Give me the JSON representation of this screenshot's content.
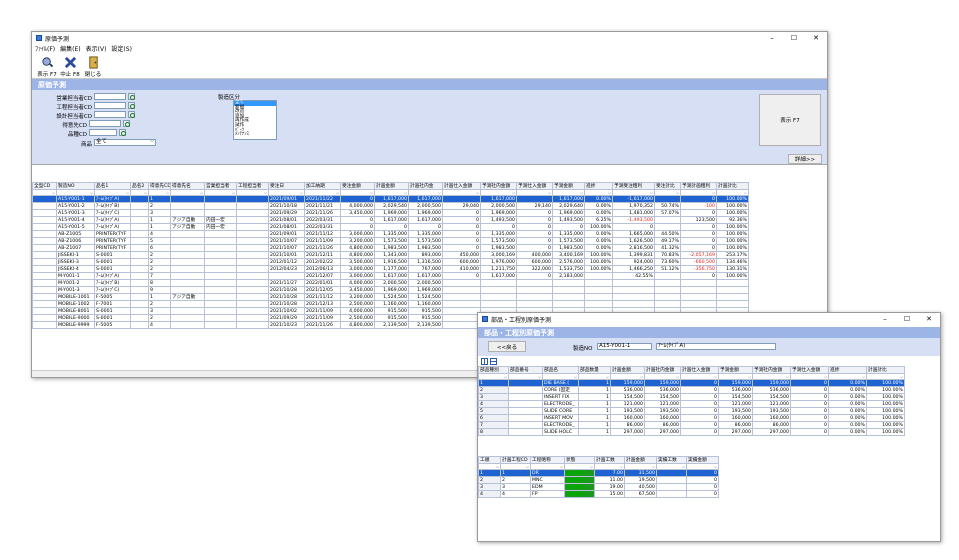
{
  "main": {
    "title": "原価予測",
    "menu": [
      "ﾌｧｲﾙ(F)",
      "編集(E)",
      "表示(V)",
      "設定(S)"
    ],
    "toolbar": [
      {
        "label": "表示 F7",
        "icon": "search-person-icon"
      },
      {
        "label": "中止 F8",
        "icon": "cross-stop-icon"
      },
      {
        "label": "閉じる",
        "icon": "close-door-icon"
      }
    ],
    "banner": "原価予測",
    "form": {
      "sales_mgr_label": "営業担当者CD",
      "process_mgr_label": "工程担当者CD",
      "design_mgr_label": "設計担当者CD",
      "customer_label": "得意先CD",
      "product_type_label": "品種CD",
      "product_label": "商品",
      "product_value": "全て",
      "manufacture_label": "製造区分",
      "manufacture_options": [
        "全て",
        "新規",
        "改造",
        "追加",
        "再作成",
        "試作",
        "ﾊﾟｰﾂ",
        "ﾒﾝﾃﾅﾝｽ"
      ],
      "show_button": "表示 F7"
    },
    "detail_button": "詳細>>",
    "columns": [
      "全型CD",
      "製造NO",
      "品名1",
      "品名2",
      "得意先CD",
      "得意先名",
      "営業担当者",
      "工程担当者",
      "受注日",
      "加工納期",
      "受注金額",
      "計画金額",
      "計画社内金",
      "計画仕入金額",
      "予測社内金額",
      "予測仕入金額",
      "予測金額",
      "進捗",
      "予測受注粗利",
      "受注計比",
      "予測計画粗利",
      "計画計比"
    ],
    "rows": [
      [
        "",
        "A15-Y001-1",
        "ｱｰﾑ(ﾀｲﾌﾟA)",
        "",
        "1",
        "",
        "",
        "",
        "2021/09/01",
        "2021/11/22",
        "0",
        "1,617,000",
        "1,617,000",
        "",
        "1,617,000",
        "",
        "1,617,000",
        "0.00%",
        "-1,617,000",
        "",
        "0",
        "100.00%"
      ],
      [
        "",
        "A15-Y001-2",
        "ｱｰﾑ(ﾀｲﾌﾟB)",
        "",
        "2",
        "",
        "",
        "",
        "2021/10/18",
        "2021/11/21",
        "4,000,000",
        "2,029,540",
        "2,000,500",
        "29,040",
        "2,000,500",
        "29,140",
        "2,029,640",
        "0.00%",
        "1,970,352",
        "50.74%",
        "-100",
        "100.00%"
      ],
      [
        "",
        "A15-Y001-3",
        "ｱｰﾑ(ﾀｲﾌﾟC)",
        "",
        "3",
        "",
        "",
        "",
        "2021/09/29",
        "2021/11/26",
        "3,450,000",
        "1,969,000",
        "1,969,000",
        "0",
        "1,969,000",
        "0",
        "1,969,000",
        "0.00%",
        "1,481,000",
        "57.07%",
        "0",
        "100.00%"
      ],
      [
        "",
        "A15-Y001-4",
        "ｱｰﾑ(ﾀｲﾌﾟA)",
        "",
        "1",
        "アジア自動",
        "内田一宏",
        "",
        "2021/08/01",
        "2022/03/31",
        "0",
        "1,617,000",
        "1,617,000",
        "0",
        "1,493,500",
        "0",
        "1,493,500",
        "6.25%",
        "-1,493,500",
        "",
        "123,500",
        "92.36%"
      ],
      [
        "",
        "A15-Y001-5",
        "ｱｰﾑ(ﾀｲﾌﾟA)",
        "",
        "1",
        "アジア自動",
        "内田一宏",
        "",
        "2021/08/01",
        "2022/03/31",
        "0",
        "0",
        "0",
        "0",
        "0",
        "0",
        "0",
        "100.00%",
        "0",
        "",
        "0",
        "100.00%"
      ],
      [
        "",
        "AB-Z1005",
        "PRINTER(TYF",
        "",
        "4",
        "",
        "",
        "",
        "2021/09/01",
        "2021/11/12",
        "3,000,000",
        "1,335,000",
        "1,335,000",
        "0",
        "1,335,000",
        "0",
        "1,335,000",
        "0.00%",
        "1,665,000",
        "44.50%",
        "0",
        "100.00%"
      ],
      [
        "",
        "AB-Z1006",
        "PRINTER(TYF",
        "",
        "5",
        "",
        "",
        "",
        "2021/10/07",
        "2021/11/09",
        "3,200,000",
        "1,573,500",
        "1,573,500",
        "0",
        "1,573,500",
        "0",
        "1,573,500",
        "0.00%",
        "1,626,500",
        "49.17%",
        "0",
        "100.00%"
      ],
      [
        "",
        "AB-Z1007",
        "PRINTER(TYF",
        "",
        "6",
        "",
        "",
        "",
        "2021/10/07",
        "2021/11/26",
        "4,800,000",
        "1,983,500",
        "1,983,500",
        "0",
        "1,983,500",
        "0",
        "1,983,500",
        "0.00%",
        "2,816,500",
        "41.32%",
        "0",
        "100.00%"
      ],
      [
        "",
        "JISSEKI-1",
        "S-0001",
        "",
        "2",
        "",
        "",
        "",
        "2021/10/01",
        "2021/12/11",
        "4,800,000",
        "1,343,000",
        "893,000",
        "450,000",
        "3,000,169",
        "400,000",
        "3,400,169",
        "100.00%",
        "1,399,831",
        "70.83%",
        "-2,057,169",
        "253.17%"
      ],
      [
        "",
        "JISSEKI-3",
        "S-0001",
        "",
        "2",
        "",
        "",
        "",
        "2012/01/12",
        "2012/02/22",
        "3,500,000",
        "1,916,500",
        "1,316,500",
        "600,000",
        "1,976,000",
        "600,000",
        "2,576,000",
        "100.00%",
        "924,000",
        "73.60%",
        "-660,500",
        "134.46%"
      ],
      [
        "",
        "JISSEKI-4",
        "S-0001",
        "",
        "2",
        "",
        "",
        "",
        "2012/04/23",
        "2012/06/13",
        "3,000,000",
        "1,177,000",
        "767,000",
        "410,000",
        "1,211,750",
        "322,000",
        "1,533,750",
        "100.00%",
        "1,466,250",
        "51.12%",
        "-356,750",
        "130.31%"
      ],
      [
        "",
        "M-Y001-1",
        "ｱｰﾑ(ﾀｲﾌﾟA)",
        "",
        "7",
        "",
        "",
        "",
        "",
        "2021/12/07",
        "3,000,000",
        "1,617,000",
        "1,617,000",
        "0",
        "1,617,000",
        "0",
        "2,183,000",
        "",
        "42.55%",
        "",
        "0",
        "100.00%"
      ],
      [
        "",
        "M-Y001-2",
        "ｱｰﾑ(ﾀｲﾌﾟB)",
        "",
        "8",
        "",
        "",
        "",
        "2021/11/27",
        "2022/01/01",
        "4,000,000",
        "2,000,500",
        "2,000,500",
        "",
        "",
        "",
        "",
        "",
        "",
        "",
        "",
        ""
      ],
      [
        "",
        "M-Y001-3",
        "ｱｰﾑ(ﾀｲﾌﾟC)",
        "",
        "9",
        "",
        "",
        "",
        "2021/10/28",
        "2021/12/05",
        "3,450,000",
        "1,969,000",
        "1,969,000",
        "",
        "",
        "",
        "",
        "",
        "",
        "",
        "",
        ""
      ],
      [
        "",
        "MOBILE-1001",
        "F-5005",
        "",
        "1",
        "アジア自動",
        "",
        "",
        "2021/10/28",
        "2021/11/12",
        "3,200,000",
        "1,524,500",
        "1,524,500",
        "",
        "",
        "",
        "",
        "",
        "",
        "",
        "",
        ""
      ],
      [
        "",
        "MOBILE-1002",
        "F-7001",
        "",
        "2",
        "",
        "",
        "",
        "2021/10/28",
        "2021/12/13",
        "2,500,000",
        "1,160,000",
        "1,160,000",
        "",
        "",
        "",
        "",
        "",
        "",
        "",
        "",
        ""
      ],
      [
        "",
        "MOBILE-8001",
        "S-0001",
        "",
        "3",
        "",
        "",
        "",
        "2021/10/02",
        "2021/11/09",
        "4,000,000",
        "915,500",
        "915,500",
        "",
        "",
        "",
        "",
        "",
        "",
        "",
        "",
        ""
      ],
      [
        "",
        "MOBILE-9000",
        "S-0001",
        "",
        "2",
        "",
        "",
        "",
        "2021/09/29",
        "2021/11/09",
        "2,500,000",
        "915,500",
        "915,500",
        "",
        "",
        "",
        "",
        "",
        "",
        "",
        "",
        ""
      ],
      [
        "",
        "MOBILE-9999",
        "F-5005",
        "",
        "4",
        "",
        "",
        "",
        "2021/10/23",
        "2021/11/26",
        "4,800,000",
        "2,139,500",
        "2,139,500",
        "",
        "",
        "",
        "",
        "",
        "",
        "",
        "",
        ""
      ]
    ]
  },
  "sub": {
    "title": "部品・工程別原価予測",
    "banner": "部品・工程別原価予測",
    "back_button": "<<戻る",
    "order_no_label": "製造NO",
    "order_no_value": "A15-Y001-1",
    "order_name_value": "ｱｰﾑ(ﾀｲﾌﾟA)",
    "parts_columns": [
      "部品種別",
      "部品番号",
      "部品名",
      "部品数量",
      "計画金額",
      "計画社内金額",
      "計画仕入金額",
      "予測金額",
      "予測社内金額",
      "予測仕入金額",
      "進捗",
      "計画計比"
    ],
    "parts_rows": [
      [
        "1",
        "",
        "DIE BASE (",
        "1",
        "159,000",
        "159,000",
        "0",
        "159,000",
        "159,000",
        "0",
        "0.00%",
        "100.00%"
      ],
      [
        "2",
        "",
        "CORE (固定",
        "1",
        "536,000",
        "536,000",
        "0",
        "536,000",
        "536,000",
        "0",
        "0.00%",
        "100.00%"
      ],
      [
        "3",
        "",
        "INSERT FIX",
        "1",
        "154,500",
        "154,500",
        "0",
        "154,500",
        "154,500",
        "0",
        "0.00%",
        "100.00%"
      ],
      [
        "4",
        "",
        "ELECTRODE_",
        "1",
        "121,000",
        "121,000",
        "0",
        "121,000",
        "121,000",
        "0",
        "0.00%",
        "100.00%"
      ],
      [
        "5",
        "",
        "SLIDE CORE",
        "1",
        "193,500",
        "193,500",
        "0",
        "193,500",
        "193,500",
        "0",
        "0.00%",
        "100.00%"
      ],
      [
        "6",
        "",
        "INSERT MOV",
        "1",
        "160,000",
        "160,000",
        "0",
        "160,000",
        "160,000",
        "0",
        "0.00%",
        "100.00%"
      ],
      [
        "7",
        "",
        "ELECTRODE_",
        "1",
        "86,000",
        "86,000",
        "0",
        "86,000",
        "86,000",
        "0",
        "0.00%",
        "100.00%"
      ],
      [
        "8",
        "",
        "SLIDE HOLC",
        "1",
        "297,000",
        "297,000",
        "0",
        "297,000",
        "297,000",
        "0",
        "0.00%",
        "100.00%"
      ]
    ],
    "process_columns": [
      "工順",
      "計画工程CD",
      "工程略称",
      "状態",
      "計画工数",
      "計画金額",
      "実績工数",
      "実績金額"
    ],
    "process_rows": [
      [
        "1",
        "1",
        "DR",
        "■■■■",
        "7.00",
        "31,500",
        "",
        "0"
      ],
      [
        "2",
        "2",
        "MNC",
        "■■■■",
        "11.00",
        "19,500",
        "",
        "0"
      ],
      [
        "3",
        "3",
        "EDM",
        "■■■■",
        "19.00",
        "40,500",
        "",
        "0"
      ],
      [
        "4",
        "4",
        "FP",
        "■■■■",
        "15.00",
        "67,500",
        "",
        "0"
      ]
    ]
  }
}
